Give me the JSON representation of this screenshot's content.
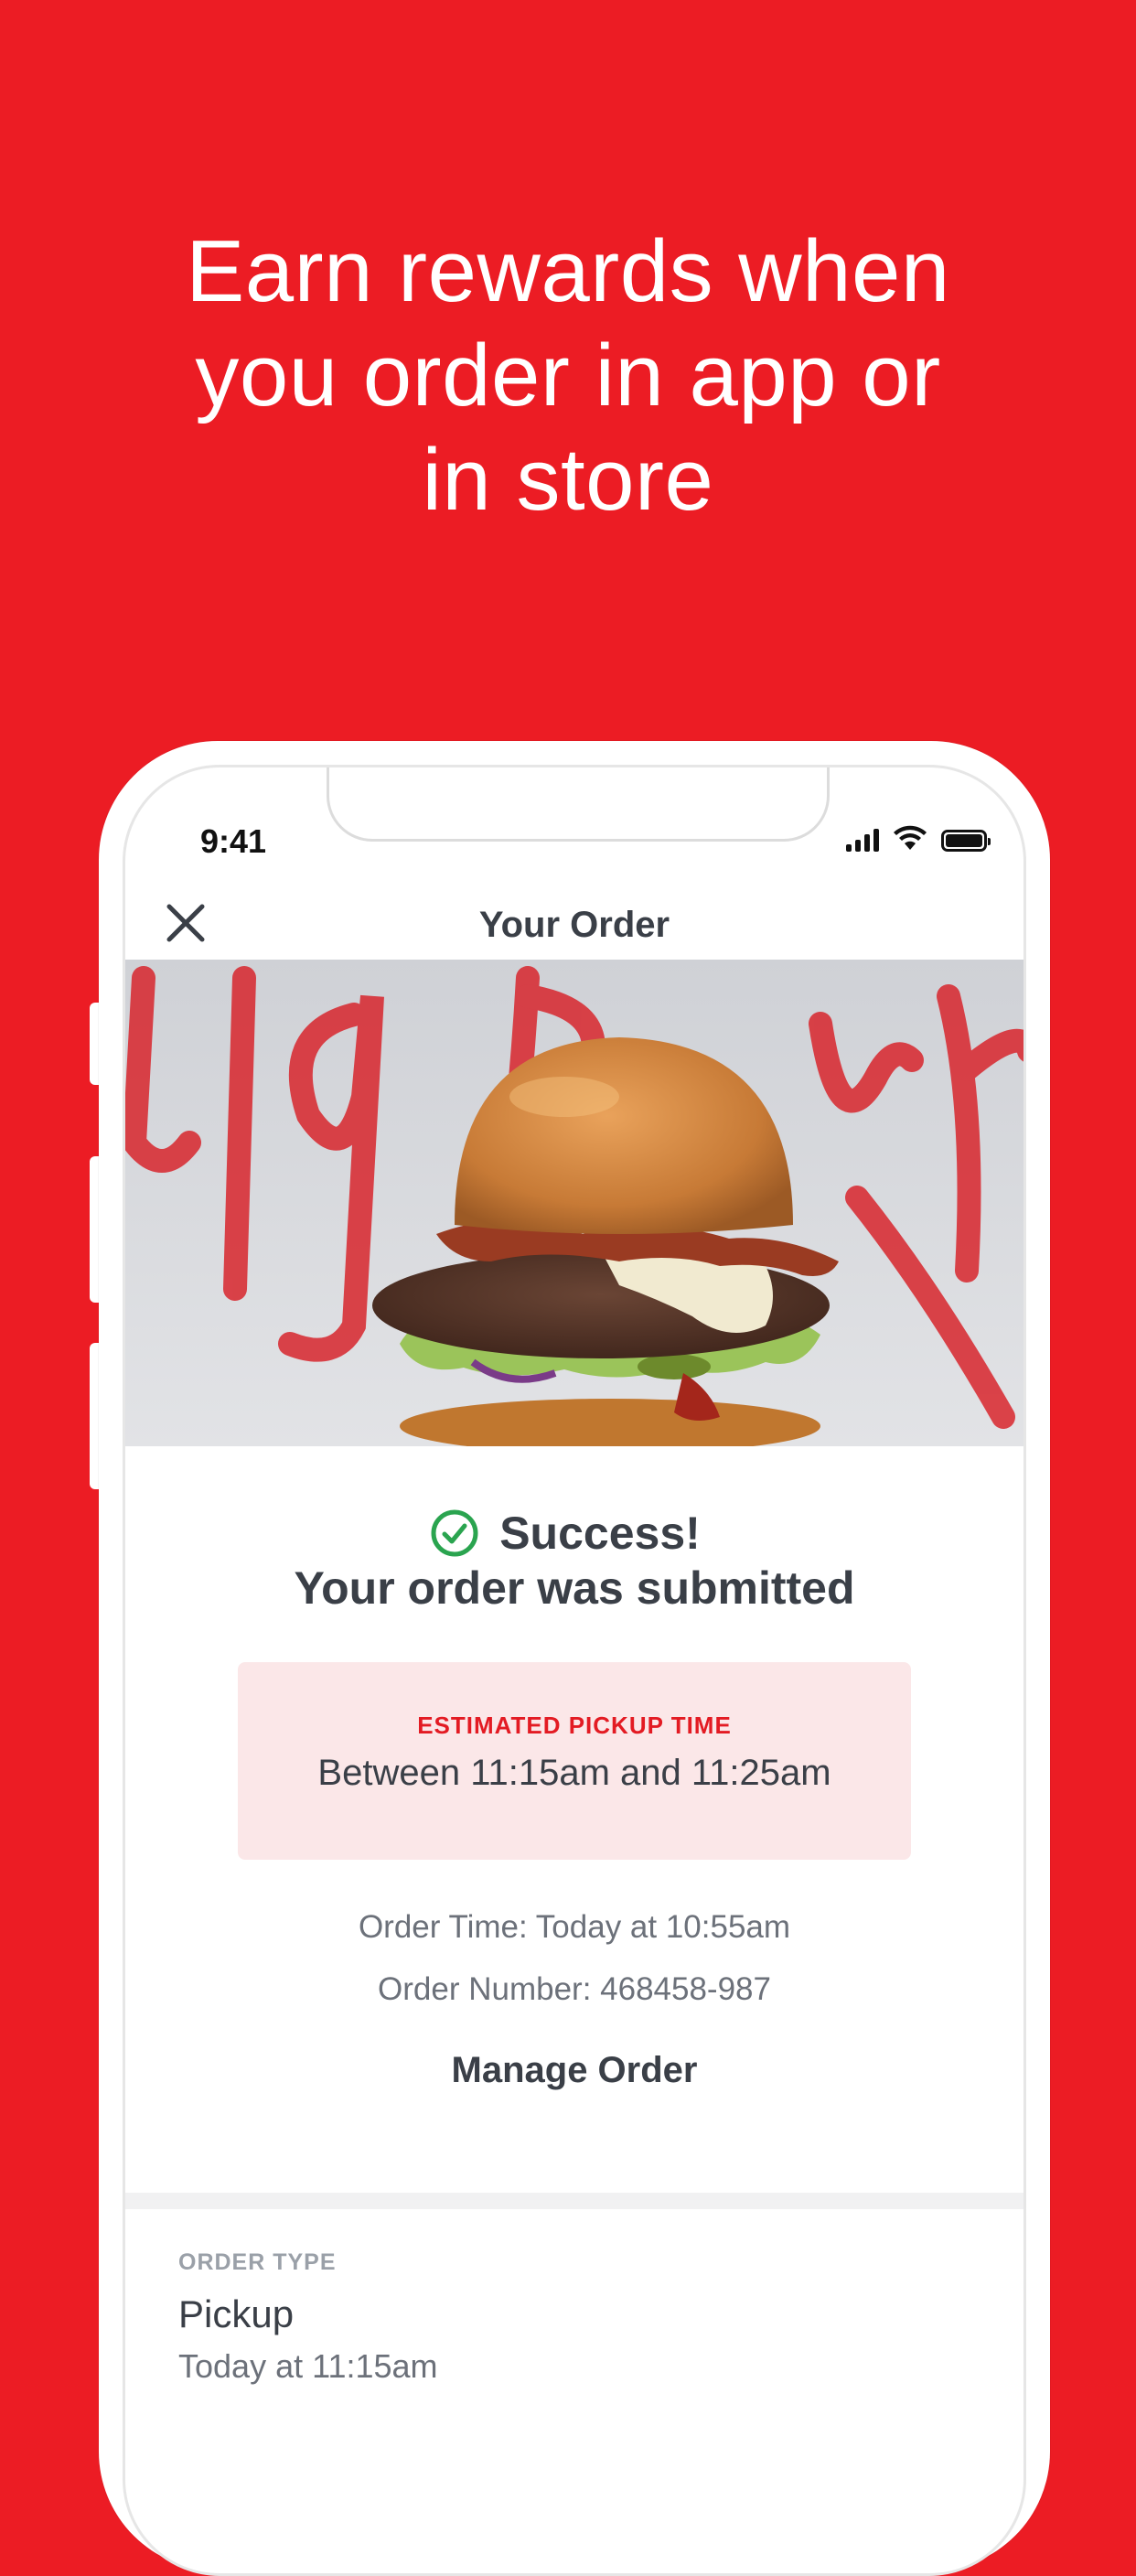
{
  "marketing": {
    "headline_line1": "Earn rewards when",
    "headline_line2": "you order in app or",
    "headline_line3": "in store",
    "background_color": "#ec1c24"
  },
  "status_bar": {
    "time": "9:41"
  },
  "navbar": {
    "title": "Your Order",
    "close_icon": "close-icon"
  },
  "hero": {
    "image": "burger-photo",
    "brand_script": "Big Burg"
  },
  "confirmation": {
    "success_title": "Success!",
    "submitted_text": "Your order was submitted",
    "check_icon": "check-circle-icon",
    "check_color": "#2aa44f",
    "pickup_label": "ESTIMATED PICKUP TIME",
    "pickup_window": "Between 11:15am and 11:25am",
    "order_time": "Order Time: Today at 10:55am",
    "order_number": "Order Number: 468458-987",
    "manage_label": "Manage Order"
  },
  "order_type": {
    "label": "ORDER TYPE",
    "value": "Pickup",
    "time": "Today at 11:15am"
  }
}
